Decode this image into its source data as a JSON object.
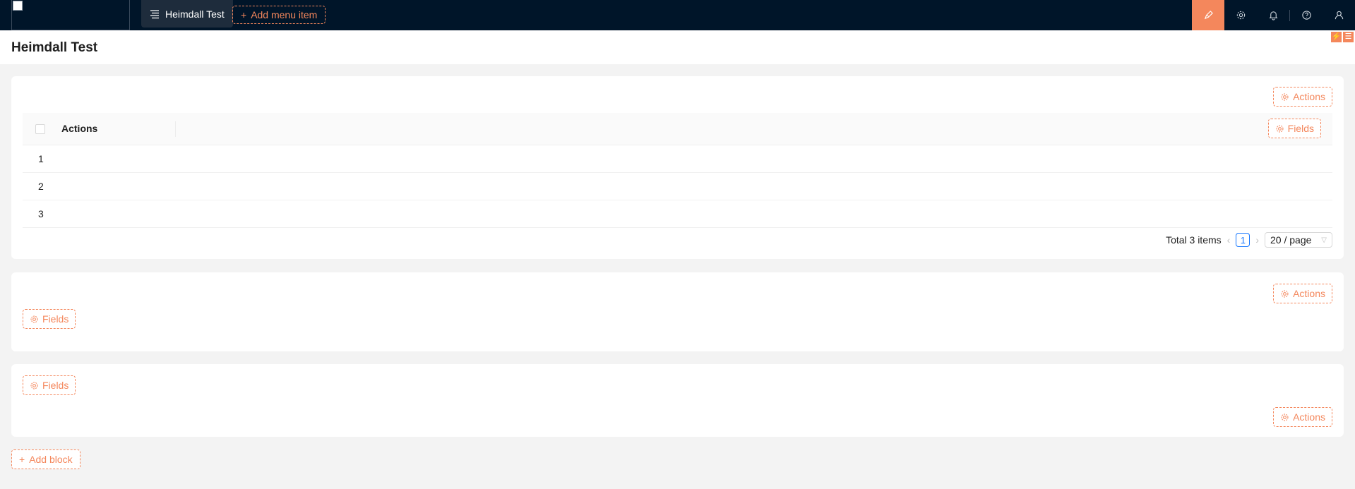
{
  "topbar": {
    "menu_item_label": "Heimdall Test",
    "add_menu_label": "Add menu item",
    "icons": [
      "ui-editor-icon",
      "settings-icon",
      "notification-icon",
      "help-icon",
      "user-icon"
    ],
    "accent_color": "#f4875c",
    "background_color": "#001529"
  },
  "page": {
    "title": "Heimdall Test"
  },
  "table_block": {
    "actions_label": "Actions",
    "fields_label": "Fields",
    "columns": [
      "Actions"
    ],
    "rows": [
      "1",
      "2",
      "3"
    ],
    "pagination": {
      "total_text": "Total 3 items",
      "current_page": "1",
      "page_size": "20 / page"
    }
  },
  "block2": {
    "actions_label": "Actions",
    "fields_label": "Fields"
  },
  "block3": {
    "fields_label": "Fields",
    "actions_label": "Actions"
  },
  "add_block_label": "Add block"
}
